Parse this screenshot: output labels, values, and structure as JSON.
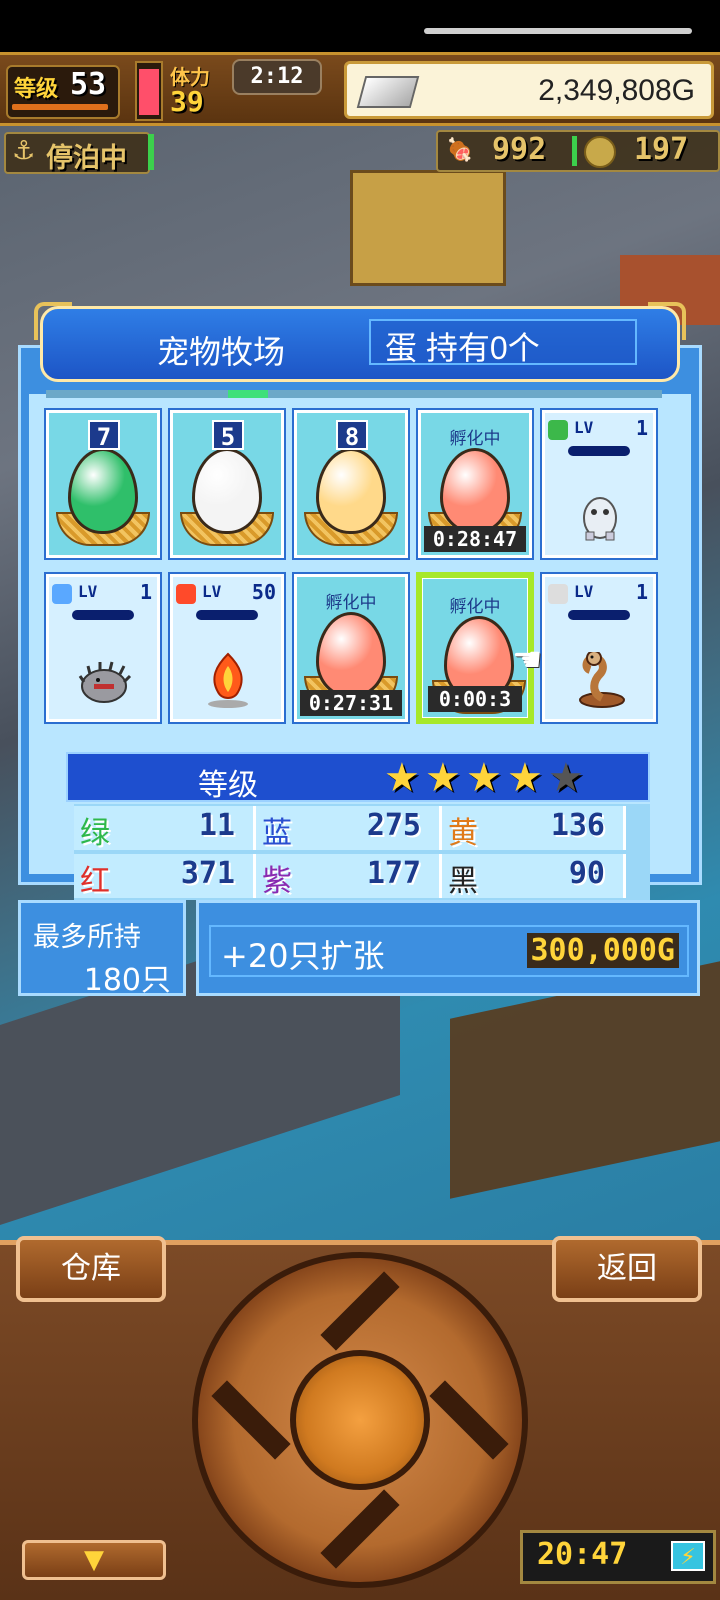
{
  "hud": {
    "level_label": "等级",
    "level": "53",
    "stamina_label": "体力",
    "stamina": "39",
    "timer": "2:12",
    "gold": "2,349,808G",
    "status": "停泊中",
    "food": "992",
    "medals": "197"
  },
  "ranch": {
    "title": "宠物牧场",
    "egg_count": "蛋 持有0个",
    "slots": [
      {
        "type": "egg",
        "num": "7",
        "color": "#2fbf6a"
      },
      {
        "type": "egg",
        "num": "5",
        "color": "#f4f4f4"
      },
      {
        "type": "egg",
        "num": "8",
        "color": "#ffd98a"
      },
      {
        "type": "hatching",
        "label": "孵化中",
        "time": "0:28:47",
        "color": "#ff8a74"
      },
      {
        "type": "pet",
        "lv_label": "LV",
        "lv": "1",
        "elem_color": "#3cb84a",
        "sprite": "yeti"
      },
      {
        "type": "pet",
        "lv_label": "LV",
        "lv": "1",
        "elem_color": "#5aa8ff",
        "sprite": "hedgehog"
      },
      {
        "type": "pet",
        "lv_label": "LV",
        "lv": "50",
        "elem_color": "#ff4a2a",
        "sprite": "fire-spirit"
      },
      {
        "type": "hatching",
        "label": "孵化中",
        "time": "0:27:31",
        "color": "#ff8a74"
      },
      {
        "type": "hatching",
        "label": "孵化中",
        "time": "0:00:3",
        "color": "#ff8a74",
        "selected": true
      },
      {
        "type": "pet",
        "lv_label": "LV",
        "lv": "1",
        "elem_color": "#dddddd",
        "sprite": "cobra"
      }
    ]
  },
  "stats": {
    "grade_label": "等级",
    "stars": 4,
    "stars_max": 5,
    "rows": [
      [
        {
          "label": "绿",
          "value": "11",
          "color": "#2fb84a"
        },
        {
          "label": "蓝",
          "value": "275",
          "color": "#2a4ed0"
        },
        {
          "label": "黄",
          "value": "136",
          "color": "#e07a1a"
        }
      ],
      [
        {
          "label": "红",
          "value": "371",
          "color": "#e0302a"
        },
        {
          "label": "紫",
          "value": "177",
          "color": "#8a2ab0"
        },
        {
          "label": "黑",
          "value": "90",
          "color": "#222222"
        }
      ]
    ]
  },
  "capacity": {
    "label": "最多所持",
    "value": "180只",
    "expand_label": "+20只扩张",
    "expand_price": "300,000G"
  },
  "controls": {
    "warehouse": "仓库",
    "back": "返回",
    "down_arrow": "▼",
    "clock": "20:47"
  }
}
